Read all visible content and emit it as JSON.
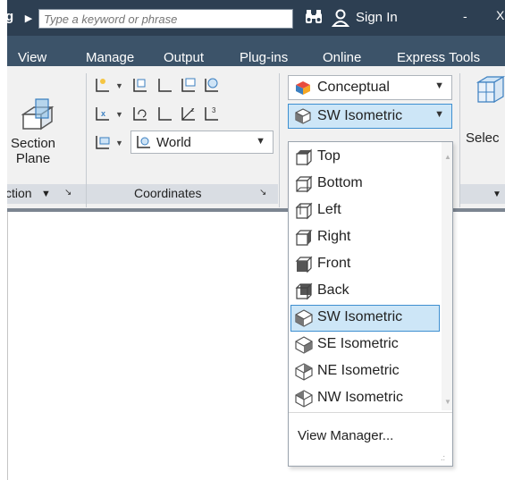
{
  "titlebar": {
    "search_placeholder": "Type a keyword or phrase",
    "signin_label": "Sign In",
    "minimize_glyph": "-",
    "close_glyph": "X",
    "truncated_glyph": "g"
  },
  "tabs": [
    {
      "label": "View"
    },
    {
      "label": "Manage"
    },
    {
      "label": "Output"
    },
    {
      "label": "Plug-ins"
    },
    {
      "label": "Online"
    },
    {
      "label": "Express Tools"
    }
  ],
  "ribbon": {
    "section_plane": {
      "line1": "Section",
      "line2": "Plane"
    },
    "section_panel_title": "ction",
    "coordinates_panel_title": "Coordinates",
    "ucs_combo_label": "World",
    "visual_style": "Conceptual",
    "view_combo": "SW Isometric",
    "select_label": "Selec"
  },
  "view_dropdown": {
    "items": [
      {
        "label": "Top",
        "icon": "top-view-icon"
      },
      {
        "label": "Bottom",
        "icon": "bottom-view-icon"
      },
      {
        "label": "Left",
        "icon": "left-view-icon"
      },
      {
        "label": "Right",
        "icon": "right-view-icon"
      },
      {
        "label": "Front",
        "icon": "front-view-icon"
      },
      {
        "label": "Back",
        "icon": "back-view-icon"
      },
      {
        "label": "SW Isometric",
        "icon": "sw-isometric-icon",
        "selected": true
      },
      {
        "label": "SE Isometric",
        "icon": "se-isometric-icon"
      },
      {
        "label": "NE Isometric",
        "icon": "ne-isometric-icon"
      },
      {
        "label": "NW Isometric",
        "icon": "nw-isometric-icon"
      }
    ],
    "view_manager_label": "View Manager..."
  },
  "colors": {
    "titlebar_bg": "#2d3f52",
    "tabs_bg": "#3c5369",
    "highlight_bg": "#cde6f7",
    "highlight_border": "#3e8fd0"
  }
}
